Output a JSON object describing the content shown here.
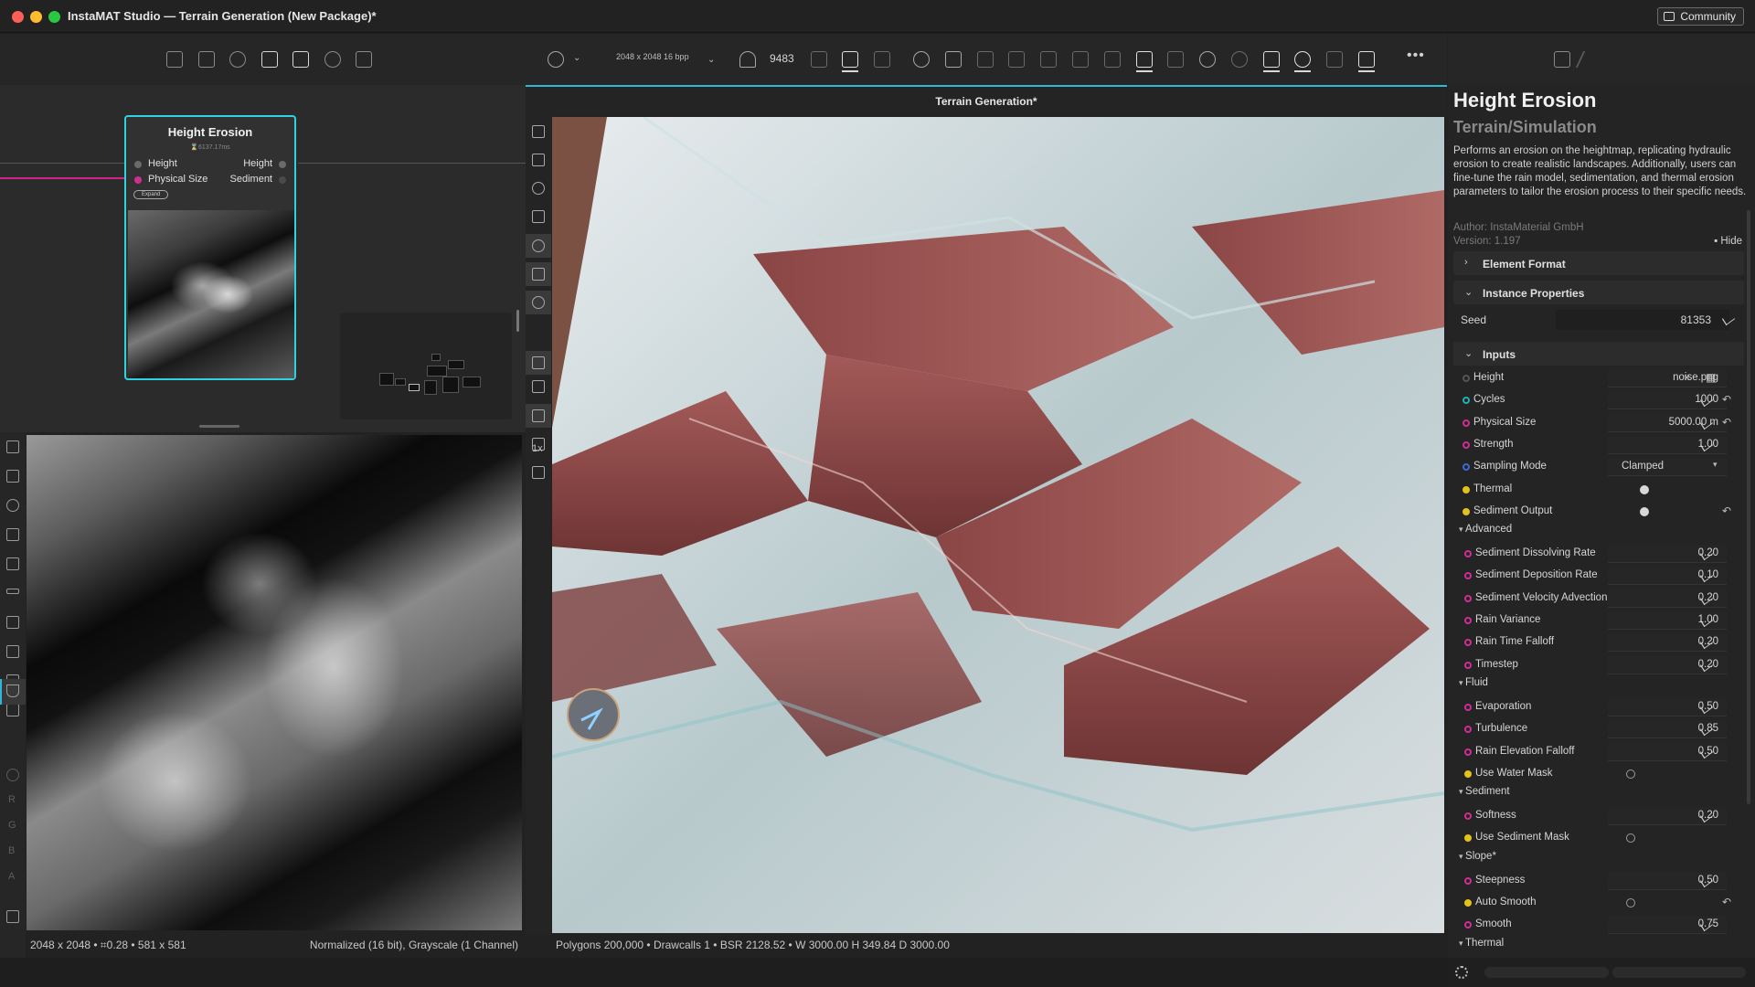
{
  "window": {
    "title": "InstaMAT Studio — Terrain Generation (New Package)*",
    "community_label": "Community"
  },
  "graph": {
    "node": {
      "title": "Height Erosion",
      "time": "⌛6137.17ms",
      "inputs": [
        "Height",
        "Physical Size"
      ],
      "outputs": [
        "Height",
        "Sediment"
      ],
      "expand_label": "Expand"
    }
  },
  "view2d": {
    "status_left": "2048 x 2048 • ⌗0.28 • 581 x 581",
    "status_right": "Normalized (16 bit), Grayscale (1 Channel)",
    "channels": [
      "R",
      "G",
      "B",
      "A"
    ]
  },
  "view3d": {
    "resolution": "2048 x 2048 16 bpp",
    "seed_count": "9483",
    "tab_title": "Terrain Generation*",
    "zoom_label": "1x",
    "status": "Polygons 200,000 • Drawcalls 1 • BSR 2128.52 • W 3000.00 H 349.84 D 3000.00",
    "colors": {
      "rock": "#8e4a4a",
      "snow": "#dfe3e5",
      "teal": "#6fb7bd",
      "sky": "#7a5244"
    }
  },
  "properties": {
    "title": "Height Erosion",
    "subtitle": "Terrain/Simulation",
    "description": "Performs an erosion on the heightmap, replicating hydraulic erosion to create realistic landscapes. Additionally, users can fine-tune the rain model, sedimentation, and thermal erosion parameters to tailor the erosion process to their specific needs.",
    "author": "Author: InstaMaterial GmbH",
    "version": "Version: 1.197",
    "hide_label": "Hide",
    "sections": {
      "element_format": "Element Format",
      "instance_properties": "Instance Properties",
      "inputs": "Inputs"
    },
    "seed": {
      "label": "Seed",
      "value": "81353"
    },
    "inputs": [
      {
        "name": "Height",
        "value": "noise.png",
        "dot": "#555555",
        "kind": "file"
      },
      {
        "name": "Cycles",
        "value": "1000",
        "dot": "#22b0b0",
        "kind": "number",
        "reset": true
      },
      {
        "name": "Physical Size",
        "value": "5000.00 m",
        "dot": "#d12e93",
        "kind": "number",
        "reset": true
      },
      {
        "name": "Strength",
        "value": "1.00",
        "dot": "#d12e93",
        "kind": "number"
      },
      {
        "name": "Sampling Mode",
        "value": "Clamped",
        "dot": "#3a6bd6",
        "kind": "select"
      },
      {
        "name": "Thermal",
        "dot": "#e3c21a",
        "kind": "toggle",
        "on": true
      },
      {
        "name": "Sediment Output",
        "dot": "#e3c21a",
        "kind": "toggle",
        "on": true,
        "reset": true
      }
    ],
    "groups": [
      {
        "label": "Advanced",
        "rows": [
          {
            "name": "Sediment Dissolving Rate",
            "value": "0.20"
          },
          {
            "name": "Sediment Deposition Rate",
            "value": "0.10"
          },
          {
            "name": "Sediment Velocity Advection",
            "value": "0.20"
          },
          {
            "name": "Rain Variance",
            "value": "1.00"
          },
          {
            "name": "Rain Time Falloff",
            "value": "0.20"
          },
          {
            "name": "Timestep",
            "value": "0.20"
          }
        ]
      },
      {
        "label": "Fluid",
        "rows": [
          {
            "name": "Evaporation",
            "value": "0.50"
          },
          {
            "name": "Turbulence",
            "value": "0.85"
          },
          {
            "name": "Rain Elevation Falloff",
            "value": "0.50"
          },
          {
            "name": "Use Water Mask",
            "toggle": true,
            "dot": "#e3c21a"
          }
        ]
      },
      {
        "label": "Sediment",
        "rows": [
          {
            "name": "Softness",
            "value": "0.20"
          },
          {
            "name": "Use Sediment Mask",
            "toggle": true,
            "dot": "#e3c21a"
          }
        ]
      },
      {
        "label": "Slope*",
        "rows": [
          {
            "name": "Steepness",
            "value": "0.50"
          },
          {
            "name": "Auto Smooth",
            "toggle": true,
            "dot": "#e3c21a",
            "reset": true
          },
          {
            "name": "Smooth",
            "value": "0.75"
          }
        ]
      },
      {
        "label": "Thermal",
        "rows": []
      }
    ]
  }
}
